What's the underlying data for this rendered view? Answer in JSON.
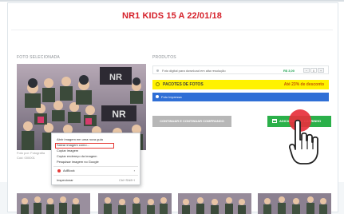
{
  "page": {
    "title": "NR1 KIDS 15 A 22/01/18",
    "left_label": "FOTO SELECIONADA",
    "right_label": "PRODUTOS"
  },
  "photo": {
    "caption_line1": "Foto por: Fotografia",
    "caption_line2": "Cód: 000001"
  },
  "context_menu": {
    "items": [
      {
        "label": "Abrir imagem em uma nova guia",
        "highlight": false
      },
      {
        "label": "Salvar imagem como...",
        "highlight": true
      },
      {
        "label": "Copiar imagem",
        "highlight": false
      },
      {
        "label": "Copiar endereço da imagem",
        "highlight": false
      },
      {
        "label": "Pesquisar imagem no Google",
        "highlight": false
      },
      {
        "label": "AdBlock",
        "highlight": false
      },
      {
        "label": "Inspecionar",
        "highlight": false
      }
    ],
    "shortcut": "Ctrl+Shift+I"
  },
  "products": {
    "row_text": "Foto digital para download em alta resolução",
    "row_price": "R$ 3,00",
    "stepper_minus": "−",
    "stepper_value": "0",
    "stepper_plus": "+",
    "package_label": "PACOTES DE FOTOS",
    "package_discount": "Até 23% de desconto",
    "printed_label": "Foto Impressa"
  },
  "buttons": {
    "secondary_label": "CONTINUAR E CONTINUAR COMPRANDO",
    "primary_label": "ADICIONAR AO CARRINHO"
  },
  "colors": {
    "title": "#d5202a",
    "yellow": "#fff200",
    "blue": "#2f6fd6",
    "green": "#2bb04a",
    "gray": "#b7b7b7"
  }
}
